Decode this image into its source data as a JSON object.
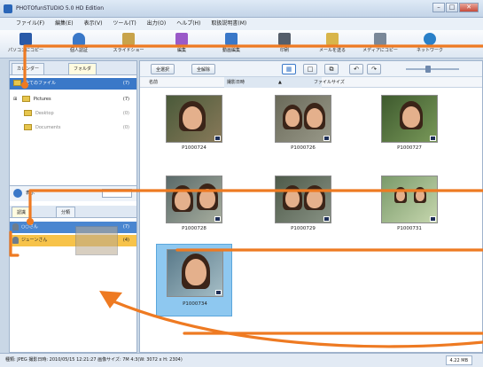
{
  "window": {
    "title": "PHOTOfunSTUDIO 5.0 HD Edition",
    "buttons": [
      "–",
      "□",
      "✕"
    ]
  },
  "menu": [
    "ファイル(F)",
    "編集(E)",
    "表示(V)",
    "ツール(T)",
    "出力(O)",
    "ヘルプ(H)",
    "取扱説明書(M)"
  ],
  "toolbar": [
    {
      "label": "パソコンにコピー",
      "icon": "import-icon",
      "color": "#2a5aa8"
    },
    {
      "label": "個人認証",
      "icon": "person-icon",
      "color": "#3a78c8"
    },
    {
      "label": "スライドショー",
      "icon": "slideshow-icon",
      "color": "#c8a34a"
    },
    {
      "label": "編集",
      "icon": "edit-icon",
      "color": "#9a5ac8"
    },
    {
      "label": "動画編集",
      "icon": "video-edit-icon",
      "color": "#3a78c8"
    },
    {
      "label": "印刷",
      "icon": "print-icon",
      "color": "#555e6a"
    },
    {
      "label": "メールを送る",
      "icon": "mail-icon",
      "color": "#d8b54a"
    },
    {
      "label": "メディアにコピー",
      "icon": "media-copy-icon",
      "color": "#7a8898"
    },
    {
      "label": "ネットワーク",
      "icon": "network-icon",
      "color": "#2a80c8"
    }
  ],
  "left": {
    "tabs": {
      "calendar": "カレンダー",
      "folder": "フォルダ"
    },
    "tree": [
      {
        "label": "全てのファイル",
        "count": "(7)",
        "selected": true
      },
      {
        "label": "Pictures",
        "count": "(7)"
      },
      {
        "label": "Desktop",
        "count": "(0)"
      },
      {
        "label": "Documents",
        "count": "(0)"
      }
    ],
    "search_label": "表示",
    "person_tabs": {
      "registered": "認識",
      "group": "分類"
    },
    "persons": [
      {
        "label": "○○さん",
        "count": "(7)",
        "selected": true
      },
      {
        "label": "ジューンさん",
        "count": "(4)",
        "highlight": true
      }
    ]
  },
  "main": {
    "buttons": {
      "select_all": "全選択",
      "deselect": "全解除"
    },
    "columns": {
      "name": "名前",
      "date": "撮影日時",
      "size": "ファイルサイズ"
    },
    "thumbnails": [
      {
        "name": "P1000724"
      },
      {
        "name": "P1000726"
      },
      {
        "name": "P1000727"
      },
      {
        "name": "P1000728"
      },
      {
        "name": "P1000729"
      },
      {
        "name": "P1000731"
      },
      {
        "name": "P1000734",
        "selected": true
      }
    ]
  },
  "status": {
    "text": "種類: JPEG  撮影日時: 2010/05/15 12:21:27  画像サイズ: 7M 4:3(W: 3072 x H: 2304)",
    "size": "4.22 MB"
  },
  "colors": {
    "accent": "#3a78c8",
    "annotation": "#ee7a22",
    "selected_thumb": "#8ec8f0"
  }
}
